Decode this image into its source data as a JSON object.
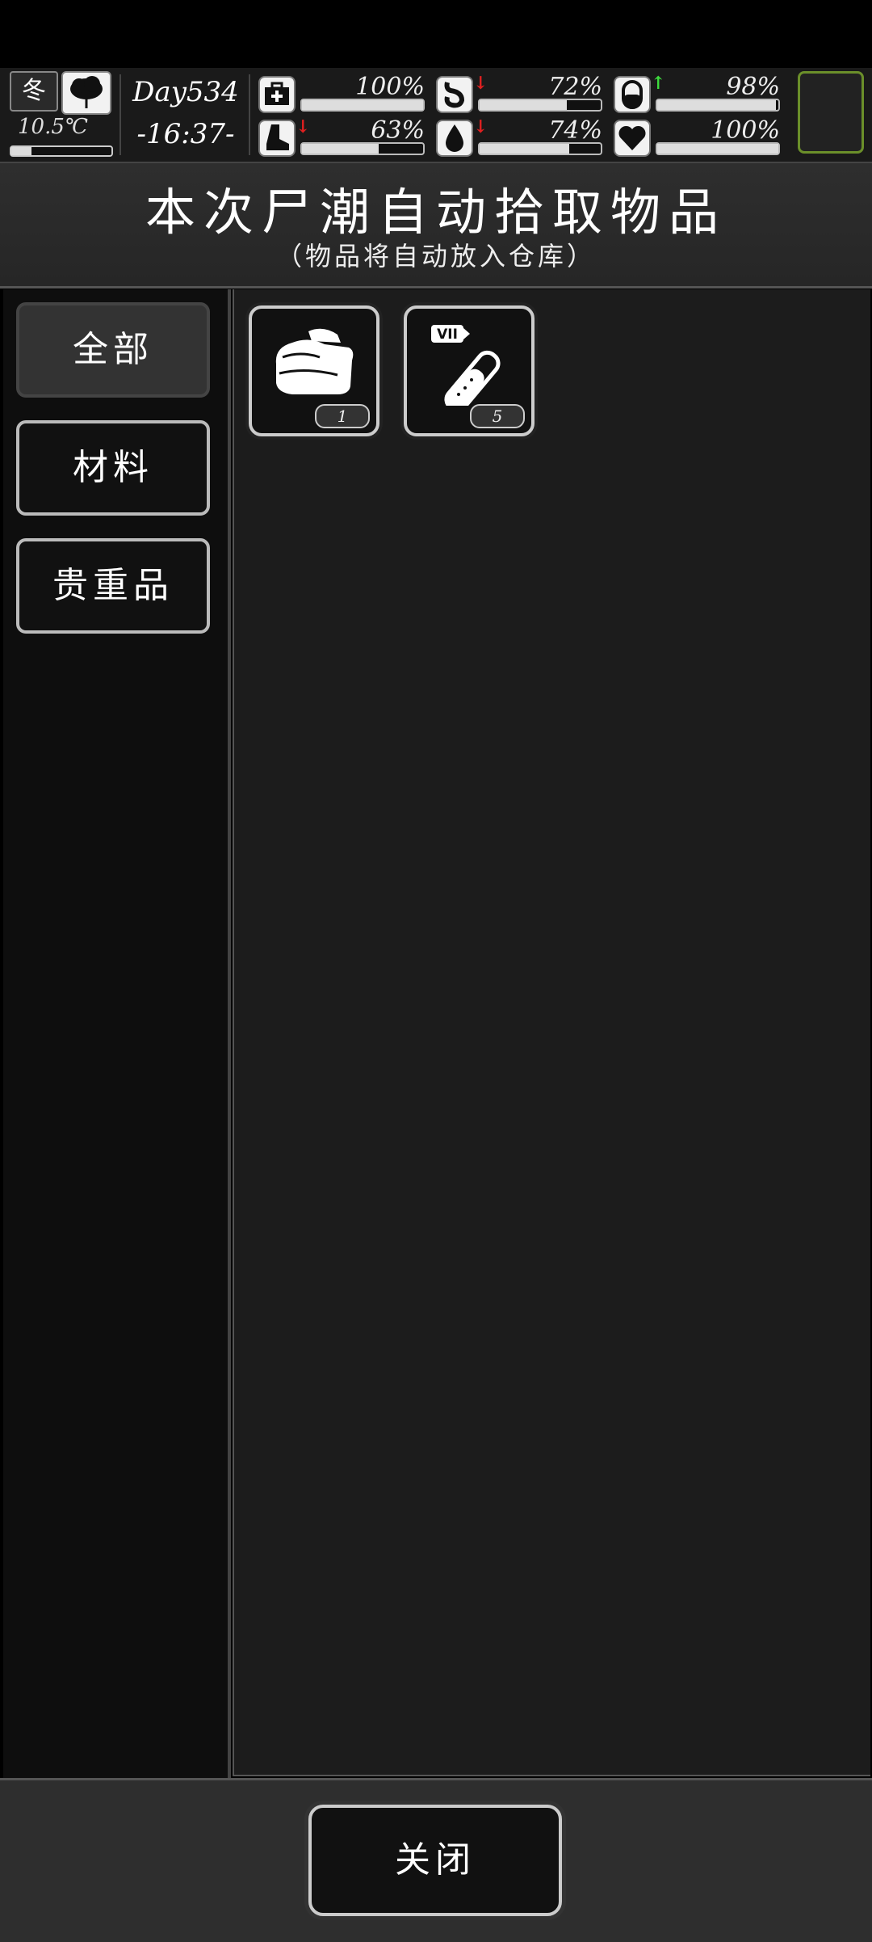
{
  "status": {
    "season": "冬",
    "temperature": "10.5℃",
    "temperature_level": 0.2,
    "day": "Day534",
    "time": "-16:37-",
    "stats": [
      {
        "name": "health",
        "icon": "medkit-icon",
        "value": "100%",
        "level": 1.0,
        "trend": ""
      },
      {
        "name": "hunger",
        "icon": "stomach-icon",
        "value": "72%",
        "level": 0.72,
        "trend": "down"
      },
      {
        "name": "immunity",
        "icon": "pill-icon",
        "value": "98%",
        "level": 0.98,
        "trend": "up"
      },
      {
        "name": "stamina",
        "icon": "boot-icon",
        "value": "63%",
        "level": 0.63,
        "trend": "down"
      },
      {
        "name": "thirst",
        "icon": "water-drop-icon",
        "value": "74%",
        "level": 0.74,
        "trend": "down"
      },
      {
        "name": "mood",
        "icon": "heart-icon",
        "value": "100%",
        "level": 1.0,
        "trend": ""
      }
    ],
    "colors": {
      "up": "#3ddc3d",
      "down": "#e02020",
      "portrait_border": "#6b8f2a"
    }
  },
  "header": {
    "title": "本次尸潮自动拾取物品",
    "subtitle": "（物品将自动放入仓库）"
  },
  "tabs": [
    {
      "label": "全部",
      "active": true
    },
    {
      "label": "材料",
      "active": false
    },
    {
      "label": "贵重品",
      "active": false
    }
  ],
  "items": [
    {
      "name": "cloth",
      "icon": "folded-cloth-icon",
      "count": "1"
    },
    {
      "name": "test-tube",
      "icon": "test-tube-icon",
      "tag": "VII",
      "count": "5"
    }
  ],
  "footer": {
    "close_label": "关闭"
  }
}
